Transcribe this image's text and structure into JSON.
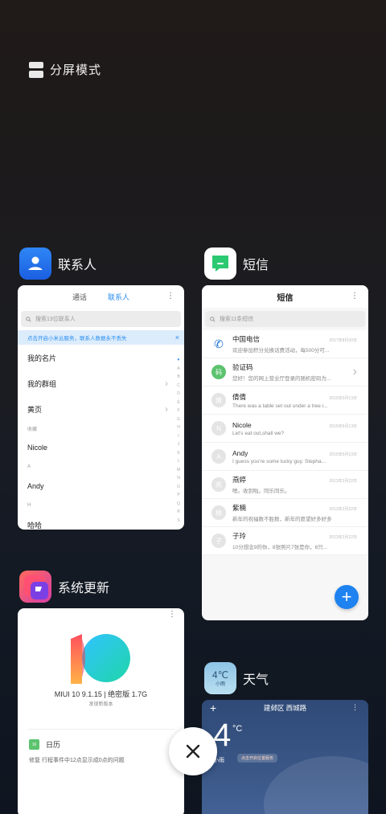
{
  "split_screen": {
    "label": "分屏模式"
  },
  "apps": {
    "contacts": {
      "name": "联系人",
      "tabs": [
        "通话",
        "联系人"
      ],
      "active_tab": "联系人",
      "search_placeholder": "搜索13位联系人",
      "notice": "点击开启小米云服务，联系人数据永不丢失",
      "rows": [
        {
          "type": "item",
          "label": "我的名片"
        },
        {
          "type": "item",
          "label": "我的群组",
          "chevron": true
        },
        {
          "type": "item",
          "label": "黄页",
          "chevron": true
        },
        {
          "type": "section",
          "label": "收藏"
        },
        {
          "type": "item",
          "label": "Nicole"
        },
        {
          "type": "section",
          "label": "A"
        },
        {
          "type": "item",
          "label": "Andy"
        },
        {
          "type": "section",
          "label": "H"
        },
        {
          "type": "item",
          "label": "哈哈"
        }
      ],
      "index": [
        "♥",
        "A",
        "B",
        "C",
        "D",
        "E",
        "F",
        "G",
        "H",
        "I",
        "J",
        "K",
        "L",
        "M",
        "N",
        "O",
        "P",
        "Q",
        "R",
        "S"
      ]
    },
    "messages": {
      "name": "短信",
      "title": "短信",
      "search_placeholder": "搜索11条短信",
      "threads": [
        {
          "avatar": "tele",
          "name": "中国电信",
          "time": "2017年8月30日",
          "preview": "欢迎参加积分兑换话费活动，每500分可..."
        },
        {
          "avatar": "码",
          "name": "验证码",
          "time": "",
          "preview": "您好！您的网上营业厅登录的随机密码为..."
        },
        {
          "avatar": "倩",
          "name": "倩倩",
          "time": "2015年6月13日",
          "preview": "There was a table set out under a tree i..."
        },
        {
          "avatar": "N",
          "name": "Nicole",
          "time": "2015年6月13日",
          "preview": "Let's eat out,shall we?"
        },
        {
          "avatar": "A",
          "name": "Andy",
          "time": "2015年6月13日",
          "preview": "I guess you're some lucky guy. Stepha..."
        },
        {
          "avatar": "燕",
          "name": "燕婷",
          "time": "2013年2月22日",
          "preview": "嗯。收到啦。同乐同乐。"
        },
        {
          "avatar": "楠",
          "name": "紫楠",
          "time": "2013年2月22日",
          "preview": "新年的祝福数不胜数，新年的愿望好多好多"
        },
        {
          "avatar": "子",
          "name": "子玲",
          "time": "2013年2月22日",
          "preview": "10分想念9的你，8张照片7张是你，6只..."
        }
      ],
      "fab": "+"
    },
    "update": {
      "name": "系统更新",
      "version": "MIUI 10 9.1.15 | 绝密版 1.7G",
      "note": "发现新版本",
      "item_title": "日历",
      "item_icon_text": "16",
      "item_desc": "修复 行程事件中12点显示成0点的问题"
    },
    "weather": {
      "name": "天气",
      "icon_temp": "4℃",
      "icon_desc": "小雨",
      "location": "建邺区 西城路",
      "temperature": "4",
      "unit": "°C",
      "condition": "小雨",
      "badge": "点击开启位置服务"
    }
  },
  "more_glyph": "⋮",
  "close_label": "×"
}
